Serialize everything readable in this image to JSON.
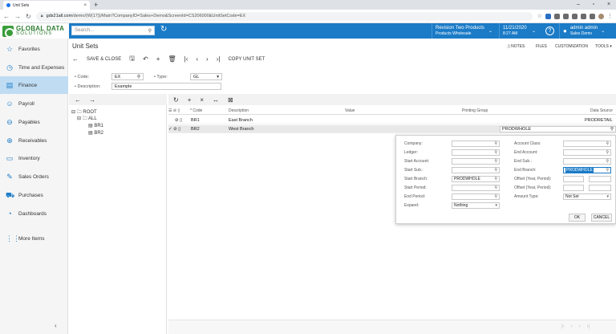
{
  "browser": {
    "tab_title": "Unit Sets",
    "url_host": "gds21all.com",
    "url_path": "/demo/(W(17))/Main?CompanyID=Sales+Demo&ScreenId=CS206000&UnitSetCode=EX"
  },
  "header": {
    "logo_line1": "GLOBAL DATA",
    "logo_line2": "SOLUTIONS",
    "search_placeholder": "Search...",
    "branch_line1": "Revision Two Products",
    "branch_line2": "Products Wholesale",
    "date_line1": "11/21/2020",
    "date_line2": "8:27 AM",
    "user_name": "admin admin",
    "user_company": "Sales Demo",
    "brand_color": "#1b7bc7"
  },
  "sidebar": {
    "items": [
      {
        "label": "Favorites",
        "icon": "star-icon",
        "glyph": "☆"
      },
      {
        "label": "Time and Expenses",
        "icon": "clock-icon",
        "glyph": "◷"
      },
      {
        "label": "Finance",
        "icon": "finance-icon",
        "glyph": "▤"
      },
      {
        "label": "Payroll",
        "icon": "payroll-icon",
        "glyph": "☺"
      },
      {
        "label": "Payables",
        "icon": "payables-icon",
        "glyph": "⊖"
      },
      {
        "label": "Receivables",
        "icon": "receivables-icon",
        "glyph": "⊕"
      },
      {
        "label": "Inventory",
        "icon": "inventory-icon",
        "glyph": "▭"
      },
      {
        "label": "Sales Orders",
        "icon": "sales-orders-icon",
        "glyph": "✎"
      },
      {
        "label": "Purchases",
        "icon": "purchases-icon",
        "glyph": "⛟"
      },
      {
        "label": "Dashboards",
        "icon": "dashboards-icon",
        "glyph": "◔"
      },
      {
        "label": "More Items",
        "icon": "more-items-icon",
        "glyph": "⋮⋮"
      }
    ],
    "active": "Finance"
  },
  "page": {
    "title": "Unit Sets",
    "notes": "NOTES",
    "files": "FILES",
    "customization": "CUSTOMIZATION",
    "tools": "TOOLS"
  },
  "toolbar": {
    "save_close": "SAVE & CLOSE",
    "copy_unit_set": "COPY UNIT SET"
  },
  "form": {
    "code_label": "Code:",
    "code_value": "EX",
    "type_label": "Type:",
    "type_value": "GL",
    "description_label": "Description:",
    "description_value": "Example"
  },
  "tree": {
    "root": "ROOT",
    "all": "ALL",
    "children": [
      "BR1",
      "BR2"
    ]
  },
  "grid": {
    "columns": {
      "code": "Code",
      "description": "Description",
      "value": "Value",
      "printing_group": "Printing Group",
      "data_source": "Data Source"
    },
    "rows": [
      {
        "code": "BR1",
        "description": "East Branch",
        "data_source": "PRODRETAIL"
      },
      {
        "code": "BR2",
        "description": "West Branch",
        "data_source": "PRODWHOLE"
      }
    ]
  },
  "popup": {
    "labels_left": [
      "Company:",
      "Ledger:",
      "Start Account:",
      "Start Sub.:",
      "Start Branch:",
      "Start Period:",
      "End Period:",
      "Expand:"
    ],
    "labels_right": [
      "Account Class:",
      "End Account:",
      "End Sub.:",
      "End Branch:",
      "Offset (Year, Period):",
      "Offset (Year, Period):",
      "Amount Type:"
    ],
    "start_branch_value": "PRODWHOLE",
    "end_branch_value": "PRODWHOLE",
    "expand_value": "Nothing",
    "amount_type_value": "Not Set",
    "ok": "OK",
    "cancel": "CANCEL"
  }
}
